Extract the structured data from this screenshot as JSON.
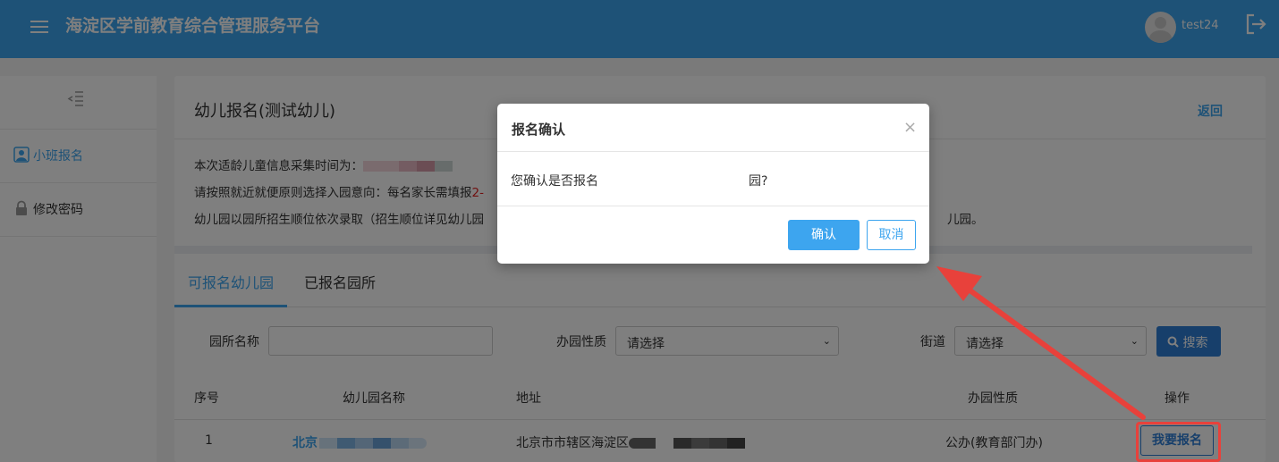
{
  "header": {
    "title": "海淀区学前教育综合管理服务平台",
    "username": "test24"
  },
  "sidebar": {
    "items": [
      {
        "label": "小班报名",
        "icon": "user-badge-icon",
        "active": true
      },
      {
        "label": "修改密码",
        "icon": "lock-icon",
        "active": false
      }
    ]
  },
  "main": {
    "title": "幼儿报名(测试幼儿)",
    "back_label": "返回",
    "notices": {
      "line1": "本次适龄儿童信息采集时间为：",
      "line2_prefix": "请按照就近就便原则选择入园意向：每名家长需填报",
      "line2_red": "2-",
      "line3_prefix": "幼儿园以园所招生顺位依次录取（招生顺位详见幼儿园",
      "line3_suffix": "儿园。"
    },
    "tabs": [
      "可报名幼儿园",
      "已报名园所"
    ],
    "filters": {
      "name_label": "园所名称",
      "nature_label": "办园性质",
      "nature_value": "请选择",
      "street_label": "街道",
      "street_value": "请选择",
      "search_label": "搜索"
    },
    "table": {
      "headers": [
        "序号",
        "幼儿园名称",
        "地址",
        "办园性质",
        "操作"
      ],
      "rows": [
        {
          "index": "1",
          "name": "北京",
          "address": "北京市市辖区海淀区",
          "nature": "公办(教育部门办)",
          "action": "我要报名"
        }
      ]
    }
  },
  "modal": {
    "title": "报名确认",
    "close": "×",
    "message": "您确认是否报名",
    "message_suffix": "园?",
    "confirm": "确认",
    "cancel": "取消"
  },
  "colors": {
    "primary": "#3da5ef",
    "button_blue": "#2f7fd6",
    "annotation_red": "#e8413b"
  }
}
